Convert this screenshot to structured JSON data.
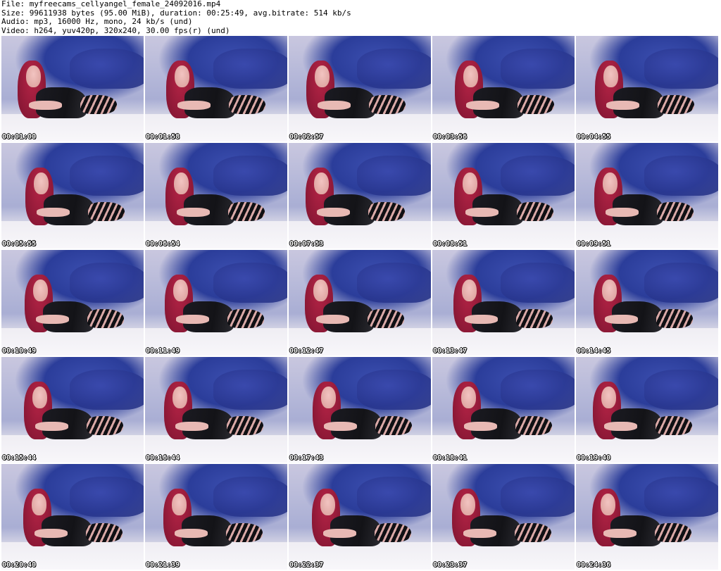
{
  "header": {
    "file": "File: myfreecams_cellyangel_female_24092016.mp4",
    "size": "Size: 99611938 bytes (95.00 MiB), duration: 00:25:49, avg.bitrate: 514 kb/s",
    "audio": "Audio: mp3, 16000 Hz, mono, 24 kb/s (und)",
    "video": "Video: h264, yuv420p, 320x240, 30.00 fps(r) (und)"
  },
  "thumbnails": [
    {
      "timestamp": "00:01:00"
    },
    {
      "timestamp": "00:01:58"
    },
    {
      "timestamp": "00:02:57"
    },
    {
      "timestamp": "00:03:56"
    },
    {
      "timestamp": "00:04:55"
    },
    {
      "timestamp": "00:05:55"
    },
    {
      "timestamp": "00:06:54"
    },
    {
      "timestamp": "00:07:53"
    },
    {
      "timestamp": "00:08:51"
    },
    {
      "timestamp": "00:09:51"
    },
    {
      "timestamp": "00:10:49"
    },
    {
      "timestamp": "00:11:49"
    },
    {
      "timestamp": "00:12:47"
    },
    {
      "timestamp": "00:13:47"
    },
    {
      "timestamp": "00:14:45"
    },
    {
      "timestamp": "00:15:44"
    },
    {
      "timestamp": "00:16:44"
    },
    {
      "timestamp": "00:17:43"
    },
    {
      "timestamp": "00:18:41"
    },
    {
      "timestamp": "00:19:40"
    },
    {
      "timestamp": "00:20:40"
    },
    {
      "timestamp": "00:21:39"
    },
    {
      "timestamp": "00:22:37"
    },
    {
      "timestamp": "00:23:37"
    },
    {
      "timestamp": "00:24:36"
    }
  ]
}
